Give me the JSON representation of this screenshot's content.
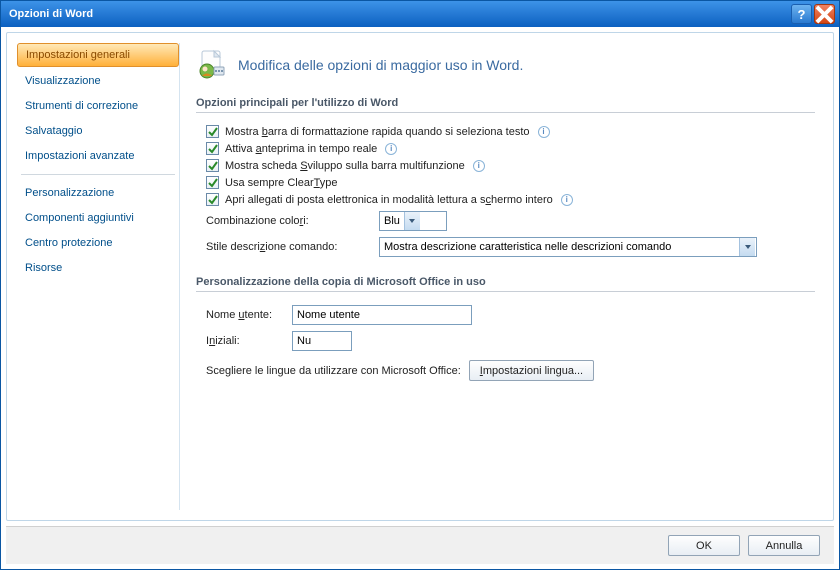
{
  "title": "Opzioni di Word",
  "sidebar": {
    "items": [
      {
        "label": "Impostazioni generali",
        "selected": true
      },
      {
        "label": "Visualizzazione"
      },
      {
        "label": "Strumenti di correzione"
      },
      {
        "label": "Salvataggio"
      },
      {
        "label": "Impostazioni avanzate"
      },
      {
        "label": "Personalizzazione"
      },
      {
        "label": "Componenti aggiuntivi"
      },
      {
        "label": "Centro protezione"
      },
      {
        "label": "Risorse"
      }
    ]
  },
  "header": {
    "subtitle": "Modifica delle opzioni di maggior uso in Word."
  },
  "section1": {
    "title": "Opzioni principali per l'utilizzo di Word",
    "cb1_pre": "Mostra ",
    "cb1_u": "b",
    "cb1_post": "arra di formattazione rapida quando si seleziona testo",
    "cb2_pre": "Attiva ",
    "cb2_u": "a",
    "cb2_post": "nteprima in tempo reale",
    "cb3_pre": "Mostra scheda ",
    "cb3_u": "S",
    "cb3_post": "viluppo sulla barra multifunzione",
    "cb4_pre": "Usa sempre Clear",
    "cb4_u": "T",
    "cb4_post": "ype",
    "cb5_pre": "Apri allegati di posta elettronica in modalità lettura a s",
    "cb5_u": "c",
    "cb5_post": "hermo intero",
    "color_label_pre": "Combinazione colo",
    "color_label_u": "r",
    "color_label_post": "i:",
    "color_value": "Blu",
    "screentip_label_pre": "Stile descri",
    "screentip_label_u": "z",
    "screentip_label_post": "ione comando:",
    "screentip_value": "Mostra descrizione caratteristica nelle descrizioni comando"
  },
  "section2": {
    "title": "Personalizzazione della copia di Microsoft Office in uso",
    "username_label_pre": "Nome ",
    "username_label_u": "u",
    "username_label_post": "tente:",
    "username_value": "Nome utente",
    "initials_label_pre": "I",
    "initials_label_u": "n",
    "initials_label_post": "iziali:",
    "initials_value": "Nu",
    "lang_label": "Scegliere le lingue da utilizzare con Microsoft Office:",
    "lang_button_u": "I",
    "lang_button_post": "mpostazioni lingua..."
  },
  "footer": {
    "ok": "OK",
    "cancel": "Annulla"
  }
}
